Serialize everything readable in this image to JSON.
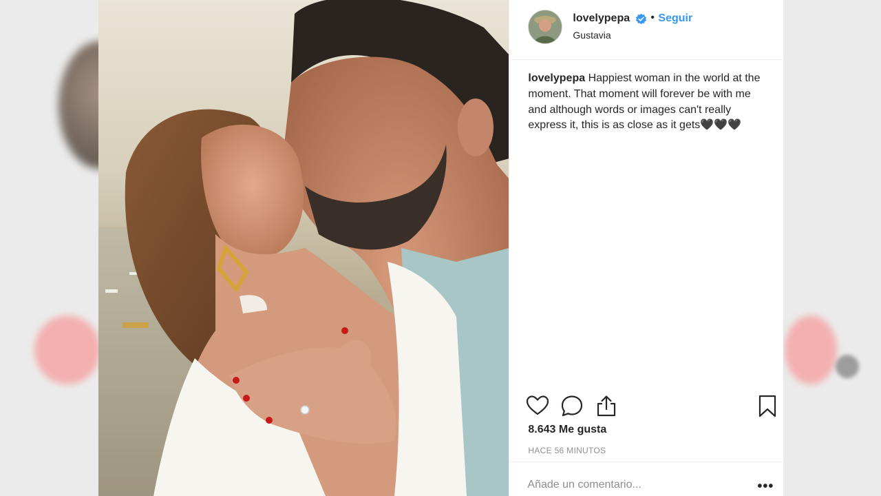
{
  "post": {
    "username": "lovelypepa",
    "follow_label": "Seguir",
    "separator": "•",
    "location": "Gustavia",
    "caption_user": "lovelypepa",
    "caption_text": "Happiest woman in the world at the moment. That moment will forever be with me and although words or images can't really express it, this is as close as it gets🖤🖤🖤",
    "likes": "8.643 Me gusta",
    "timestamp": "HACE 56 MINUTOS",
    "comment_placeholder": "Añade un comentario...",
    "more_label": "•••"
  },
  "icons": {
    "verified": "verified-badge-icon",
    "like": "heart-icon",
    "comment": "comment-bubble-icon",
    "share": "share-icon",
    "save": "bookmark-icon",
    "more": "more-options-icon"
  },
  "colors": {
    "link": "#3897f0",
    "text": "#262626",
    "muted": "#8e8e8e",
    "verified": "#3897f0",
    "divider": "#efefef"
  }
}
